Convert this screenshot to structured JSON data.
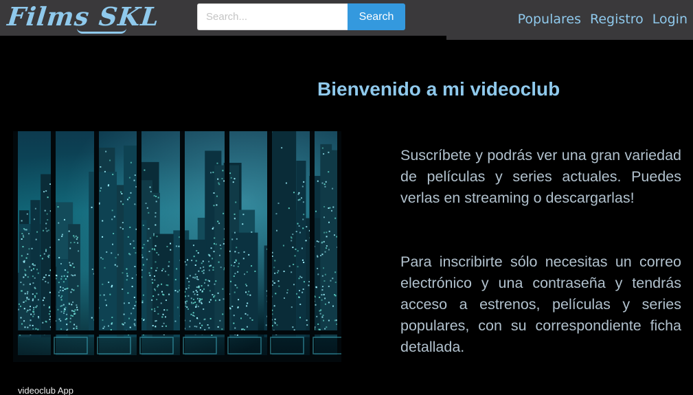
{
  "navbar": {
    "brand": "Films SKL",
    "search": {
      "placeholder": "Search...",
      "value": "",
      "button_label": "Search"
    },
    "links": [
      "Populares",
      "Registro",
      "Login"
    ]
  },
  "hero": {
    "title": "Bienvenido a mi videoclub",
    "image_alt": "city skyline at night through window panes",
    "caption": "videoclub App",
    "paragraphs": [
      "Suscríbete y podrás ver una gran variedad de películas y series actuales. Puedes verlas en streaming o descargarlas!",
      "Para inscribirte sólo necesitas un correo electrónico y una contraseña y tendrás acceso a estrenos, películas y series populares, con su correspondiente ficha detallada."
    ]
  },
  "colors": {
    "navbar_bg": "#3a393b",
    "accent": "#8fc9ec",
    "search_button": "#3499de",
    "page_bg": "#000000",
    "body_text": "#b1c1cd"
  }
}
